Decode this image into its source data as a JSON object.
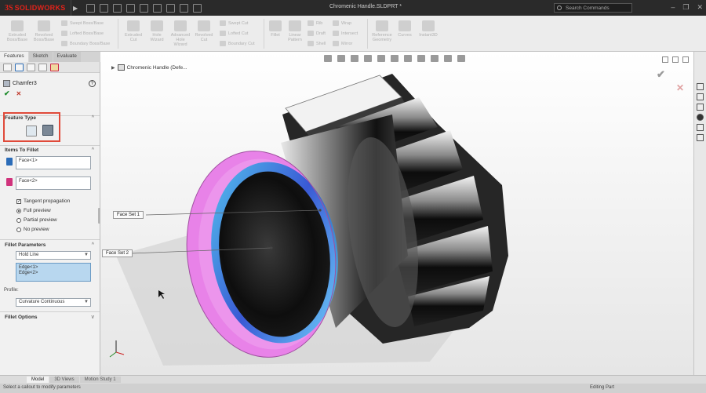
{
  "app": {
    "logo_ds": "3S",
    "logo_name": "SOLIDWORKS"
  },
  "window": {
    "title": "Chromenic Handle.SLDPRT *"
  },
  "search": {
    "placeholder": "Search Commands"
  },
  "ribbon": {
    "large": [
      "Extruded Boss/Base",
      "Revolved Boss/Base",
      "Extruded Cut",
      "Hole Wizard",
      "Advanced Hole Wizard",
      "Revolved Cut",
      "Fillet",
      "Linear Pattern",
      "Rib",
      "Draft",
      "Shell",
      "Reference Geometry",
      "Curves",
      "Instant3D"
    ],
    "small": [
      "Swept Boss/Base",
      "Lofted Boss/Base",
      "Boundary Boss/Base",
      "Swept Cut",
      "Lofted Cut",
      "Boundary Cut",
      "Wrap",
      "Intersect",
      "Mirror"
    ]
  },
  "tabs": [
    "Features",
    "Sketch",
    "Evaluate"
  ],
  "property_manager": {
    "title": "Chamfer3",
    "feature_type": {
      "label": "Feature Type"
    },
    "items_to_fillet": {
      "label": "Items To Fillet",
      "set1": "Face<1>",
      "set2": "Face<2>"
    },
    "options": {
      "tangent_propagation": "Tangent propagation",
      "full_preview": "Full preview",
      "partial_preview": "Partial preview",
      "no_preview": "No preview"
    },
    "fillet_parameters": {
      "label": "Fillet Parameters",
      "method": "Hold Line",
      "edges": [
        "Edge<1>",
        "Edge<2>"
      ],
      "profile_label": "Profile:",
      "profile": "Curvature Continuous"
    },
    "fillet_options": {
      "label": "Fillet Options"
    }
  },
  "graphics": {
    "tree_node": "Chromenic Handle  (Defe...",
    "callouts": [
      "Face Set 1",
      "Face Set 2"
    ]
  },
  "bottom_tabs": [
    "Model",
    "3D Views",
    "Motion Study 1"
  ],
  "status": {
    "left": "Select a callout to modify parameters",
    "right": "Editing Part"
  },
  "colors": {
    "accent_red": "#e2231a",
    "highlight_pink": "#e882e8",
    "highlight_cyan": "#3ad0f0"
  }
}
